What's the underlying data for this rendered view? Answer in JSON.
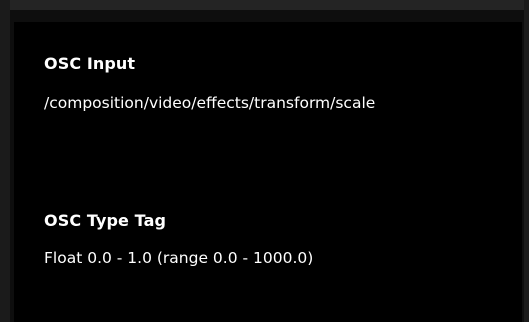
{
  "osc_input": {
    "label": "OSC Input",
    "value": "/composition/video/effects/transform/scale"
  },
  "osc_type_tag": {
    "label": "OSC Type Tag",
    "value": "Float 0.0 - 1.0 (range 0.0 - 1000.0)"
  },
  "colors": {
    "background": "#000000",
    "frame": "#1b1b1b",
    "text": "#ffffff"
  }
}
